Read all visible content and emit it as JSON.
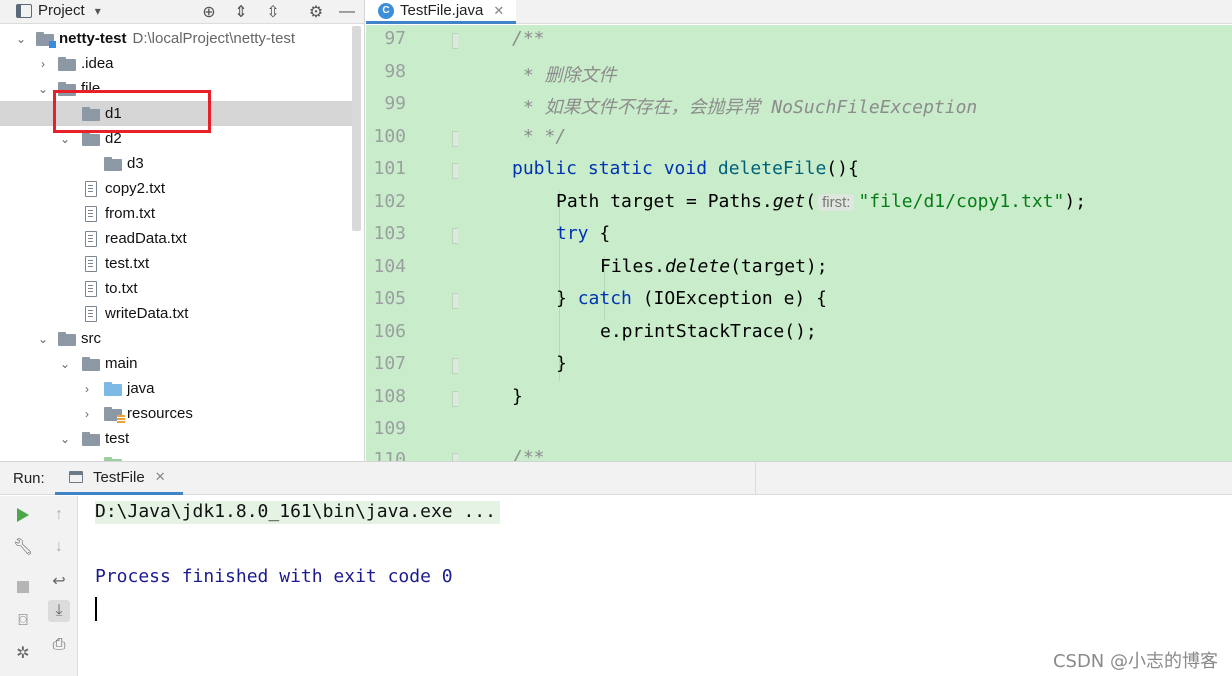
{
  "project_panel": {
    "title": "Project",
    "tree": [
      {
        "label": "netty-test",
        "hint": "D:\\localProject\\netty-test"
      },
      {
        "label": ".idea"
      },
      {
        "label": "file"
      },
      {
        "label": "d1"
      },
      {
        "label": "d2"
      },
      {
        "label": "d3"
      },
      {
        "label": "copy2.txt"
      },
      {
        "label": "from.txt"
      },
      {
        "label": "readData.txt"
      },
      {
        "label": "test.txt"
      },
      {
        "label": "to.txt"
      },
      {
        "label": "writeData.txt"
      },
      {
        "label": "src"
      },
      {
        "label": "main"
      },
      {
        "label": "java"
      },
      {
        "label": "resources"
      },
      {
        "label": "test"
      }
    ]
  },
  "editor": {
    "tab_label": "TestFile.java",
    "tab_icon_letter": "C",
    "line_numbers": [
      "97",
      "98",
      "99",
      "100",
      "101",
      "102",
      "103",
      "104",
      "105",
      "106",
      "107",
      "108",
      "109",
      "110"
    ],
    "code": {
      "l97": "/**",
      "l98": " * 删除文件",
      "l99": " * 如果文件不存在，会抛异常 NoSuchFileException",
      "l100": " * */",
      "l101_kw": "public static void ",
      "l101_fn": "deleteFile",
      "l101_rest": "(){",
      "l102_a": "Path target = Paths.",
      "l102_get": "get",
      "l102_paren": "(",
      "l102_hint": "first:",
      "l102_str": "\"file/d1/copy1.txt\"",
      "l102_end": ");",
      "l103_kw": "try",
      "l103_rest": " {",
      "l104_a": "Files.",
      "l104_del": "delete",
      "l104_rest": "(target);",
      "l105_a": "} ",
      "l105_kw": "catch",
      "l105_rest": " (IOException e) {",
      "l106": "e.printStackTrace();",
      "l107": "}",
      "l108": "}",
      "l110": "/**"
    }
  },
  "run_panel": {
    "label": "Run:",
    "tab_label": "TestFile",
    "console_lines": {
      "cmd": "D:\\Java\\jdk1.8.0_161\\bin\\java.exe ...",
      "exit": "Process finished with exit code 0"
    }
  },
  "watermark": "CSDN @小志的博客",
  "colors": {
    "accent": "#4083c9",
    "editor_highlight": "#c9eccb",
    "selection_box": "#e8202a"
  }
}
